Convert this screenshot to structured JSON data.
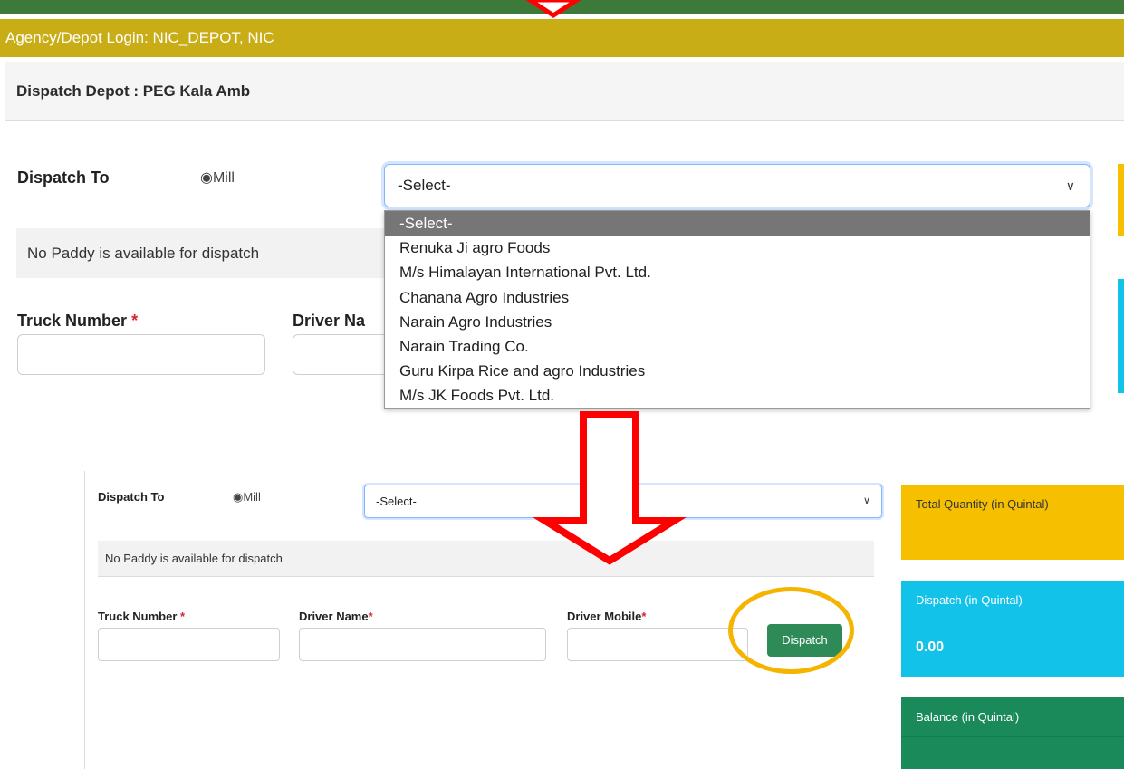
{
  "top": {
    "agency_login": "Agency/Depot Login: NIC_DEPOT, NIC",
    "dispatch_depot": "Dispatch Depot : PEG Kala Amb",
    "dispatch_to_label": "Dispatch To",
    "radio_label": "◉Mill",
    "select_value": "-Select-",
    "dropdown_options": [
      "-Select-",
      "Renuka Ji agro Foods",
      "M/s Himalayan International Pvt. Ltd.",
      "Chanana Agro Industries",
      "Narain Agro Industries",
      "Narain Trading Co.",
      "Guru Kirpa Rice and agro Industries",
      "M/s JK Foods Pvt. Ltd."
    ],
    "no_paddy": "No Paddy is available for dispatch",
    "truck_label": "Truck Number",
    "driver_label_cut": "Driver Na"
  },
  "bottom": {
    "dispatch_to_label": "Dispatch To",
    "radio_label": "◉Mill",
    "select_value": "-Select-",
    "no_paddy": "No Paddy is available for dispatch",
    "truck_label": "Truck Number",
    "driver_name_label": "Driver Name",
    "driver_mobile_label": "Driver Mobile",
    "required_mark": "*",
    "dispatch_button": "Dispatch",
    "cards": {
      "total_title": "Total Quantity (in Quintal)",
      "dispatch_title": "Dispatch (in Quintal)",
      "dispatch_value": "0.00",
      "balance_title": "Balance (in Quintal)"
    }
  },
  "colors": {
    "accent_bar": "#c9ad17",
    "annotation_arrow": "#ff0000",
    "annotation_circle": "#f4b400",
    "button": "#2e8b57"
  }
}
